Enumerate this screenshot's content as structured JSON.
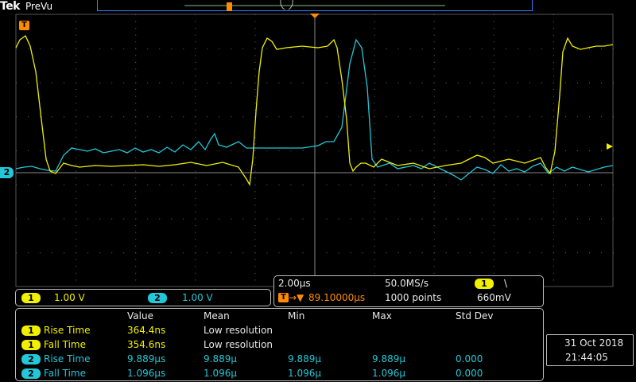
{
  "header": {
    "brand": "Tek",
    "mode": "PreVu"
  },
  "channels": {
    "ch2_marker": "2"
  },
  "ch_scale": {
    "ch1": {
      "num": "1",
      "value": "1.00 V"
    },
    "ch2": {
      "num": "2",
      "value": "1.00 V"
    }
  },
  "timebase": {
    "scale": "2.00µs",
    "sample_rate": "50.0MS/s",
    "trigger_ch": "1",
    "trigger_slope": "\\",
    "trigger_pos": "89.10000µs",
    "record": "1000 points",
    "trigger_level": "660mV"
  },
  "meas": {
    "headers": {
      "value": "Value",
      "mean": "Mean",
      "min": "Min",
      "max": "Max",
      "std": "Std Dev"
    },
    "rows": [
      {
        "ch": "1",
        "name": "Rise Time",
        "value": "364.4ns",
        "mean": "Low resolution",
        "min": "",
        "max": "",
        "std": ""
      },
      {
        "ch": "1",
        "name": "Fall Time",
        "value": "354.6ns",
        "mean": "Low resolution",
        "min": "",
        "max": "",
        "std": ""
      },
      {
        "ch": "2",
        "name": "Rise Time",
        "value": "9.889µs",
        "mean": "9.889µ",
        "min": "9.889µ",
        "max": "9.889µ",
        "std": "0.000"
      },
      {
        "ch": "2",
        "name": "Fall Time",
        "value": "1.096µs",
        "mean": "1.096µ",
        "min": "1.096µ",
        "max": "1.096µ",
        "std": "0.000"
      }
    ]
  },
  "datetime": {
    "date": "31 Oct  2018",
    "time": "21:44:05"
  },
  "colors": {
    "ch1": "#f0f000",
    "ch2": "#23c7d7",
    "trigger": "#ff8c00",
    "grid": "#5a5a5a"
  }
}
